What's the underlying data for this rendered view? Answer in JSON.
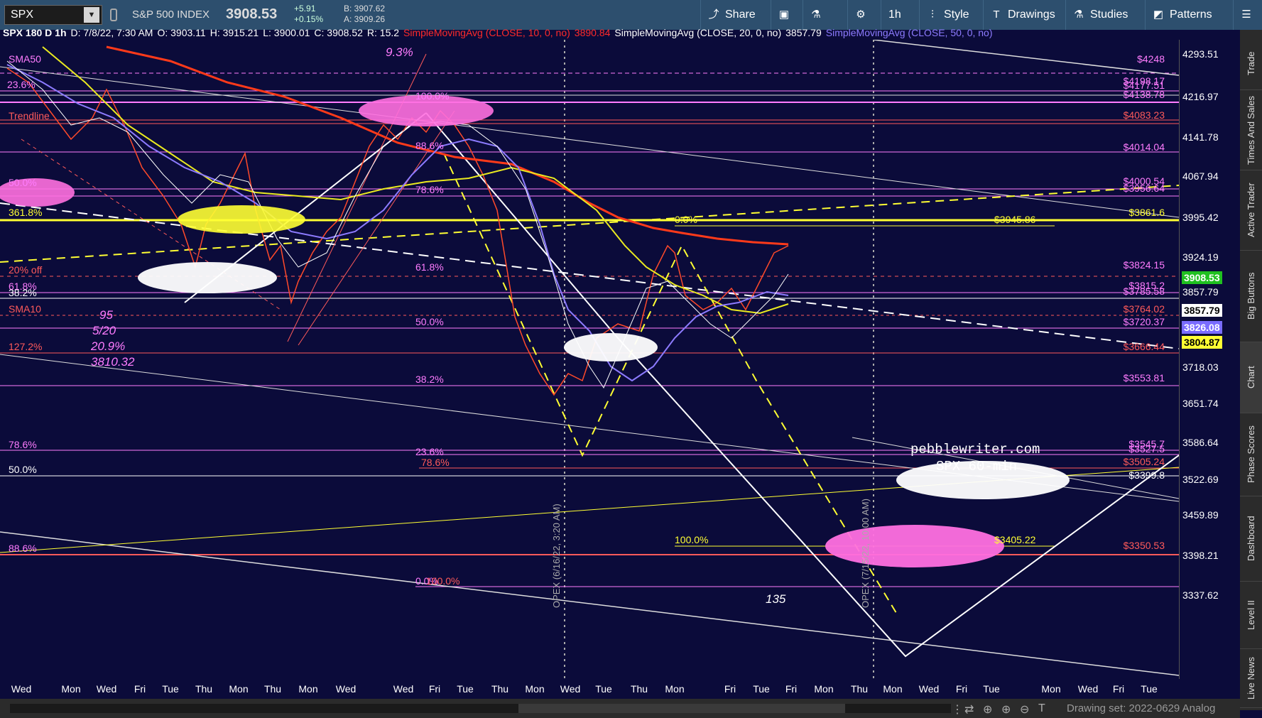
{
  "toolbar": {
    "symbol": "SPX",
    "symbol_name": "S&P 500 INDEX",
    "last_price": "3908.53",
    "change": "+5.91",
    "change_pct": "+0.15%",
    "bid": "B: 3907.62",
    "ask": "A: 3909.26",
    "share": "Share",
    "timeframe": "1h",
    "style": "Style",
    "drawings": "Drawings",
    "studies": "Studies",
    "patterns": "Patterns"
  },
  "studyline": {
    "header": "SPX 180 D 1h",
    "date": "D: 7/8/22, 7:30 AM",
    "open": "O: 3903.11",
    "high": "H: 3915.21",
    "low": "L: 3900.01",
    "close": "C: 3908.52",
    "range": "R: 15.2",
    "sma10_label": "SimpleMovingAvg (CLOSE, 10, 0, no)",
    "sma10_value": "3890.84",
    "sma20_label": "SimpleMovingAvg (CLOSE, 20, 0, no)",
    "sma20_value": "3857.79",
    "sma50_label": "SimpleMovingAvg (CLOSE, 50, 0, no)"
  },
  "colors": {
    "background": "#0b0b3a",
    "toolbar": "#2d4f6e",
    "sma10": "#ff2a2a",
    "sma20": "#ffffff",
    "sma50": "#8d7bff",
    "fib": "#ff7cff",
    "yellow": "#ffff33"
  },
  "price_axis": [
    "4293.51",
    "4216.97",
    "4141.78",
    "4067.94",
    "3995.42",
    "3924.19",
    "3857.79",
    "3785.52",
    "3718.03",
    "3651.74",
    "3586.64",
    "3522.69",
    "3459.89",
    "3398.21",
    "3337.62"
  ],
  "price_tags": {
    "last": "3908.53",
    "sma20": "3857.79",
    "sma50": "3826.08",
    "yellow": "3804.87"
  },
  "x_axis": [
    "Wed",
    "Mon",
    "Wed",
    "Fri",
    "Tue",
    "Thu",
    "Mon",
    "Thu",
    "Mon",
    "Wed",
    "Wed",
    "Fri",
    "Tue",
    "Thu",
    "Mon",
    "Wed",
    "Tue",
    "Thu",
    "Mon",
    "Fri",
    "Tue",
    "Fri",
    "Mon",
    "Thu",
    "Mon",
    "Wed",
    "Fri",
    "Tue",
    "Mon",
    "Wed",
    "Fri",
    "Tue",
    "Thu"
  ],
  "levels": [
    {
      "label": "$4248"
    },
    {
      "label": "$4198.17"
    },
    {
      "label": "$4177.51"
    },
    {
      "label": "$4138.78"
    },
    {
      "label": "$4083.23"
    },
    {
      "label": "$4014.04"
    },
    {
      "label": "$4000.54"
    },
    {
      "label": "$3956.64"
    },
    {
      "label": "$3861.6"
    },
    {
      "label": "$3824.15"
    },
    {
      "label": "$3815.2"
    },
    {
      "label": "$3785.58"
    },
    {
      "label": "$3764.02"
    },
    {
      "label": "$3720.37"
    },
    {
      "label": "$3666.44"
    },
    {
      "label": "$3553.81"
    },
    {
      "label": "$3545.7"
    },
    {
      "label": "$3527.5"
    },
    {
      "label": "$3505.24"
    },
    {
      "label": "$3399.8"
    },
    {
      "label": "$3350.53"
    }
  ],
  "annotations": {
    "watermark_line1": "pebblewriter.com",
    "watermark_line2": "SPX 60-min",
    "price_3945": "$3945.86",
    "price_3405": "$3405.22",
    "pct_0_top": "0.0%",
    "pct_100_bottom": "100.0%",
    "pct_100_top": "100.0%",
    "fib_886": "88.6%",
    "fib_786": "78.6%",
    "fib_618": "61.8%",
    "fib_50": "50.0%",
    "fib_382": "38.2%",
    "fib_236": "23.6%",
    "fib_786b": "78.6%",
    "fib_0": "0.0%",
    "fib_1000": "100.0%",
    "left_sma50": "SMA50",
    "left_236": "23.6%",
    "left_trendline": "Trendline",
    "left_500": "50.0%",
    "left_3618": "361.8%",
    "left_20off": "20% off",
    "left_618": "61.8%",
    "left_382": "38.2%",
    "left_sma10": "SMA10",
    "left_1272": "127.2%",
    "left_786": "78.6%",
    "left_500b": "50.0%",
    "left_886": "88.6%",
    "left_1000": "100.0%",
    "note_95": "95",
    "note_date": "5/20",
    "note_pct": "20.9%",
    "note_price": "3810.32",
    "note_top": "9.3%",
    "opex1": "OPEX (6/16/22, 3:20 AM)",
    "opex2": "OPEX (7/15/22, 10:00 AM)",
    "count_135": "135"
  },
  "sidebar_tabs": [
    "Trade",
    "Times And Sales",
    "Active Trader",
    "Big Buttons",
    "Chart",
    "Phase Scores",
    "Dashboard",
    "Level II",
    "Live News"
  ],
  "bottombar": {
    "drawing_set": "Drawing set: 2022-0629 Analog"
  }
}
